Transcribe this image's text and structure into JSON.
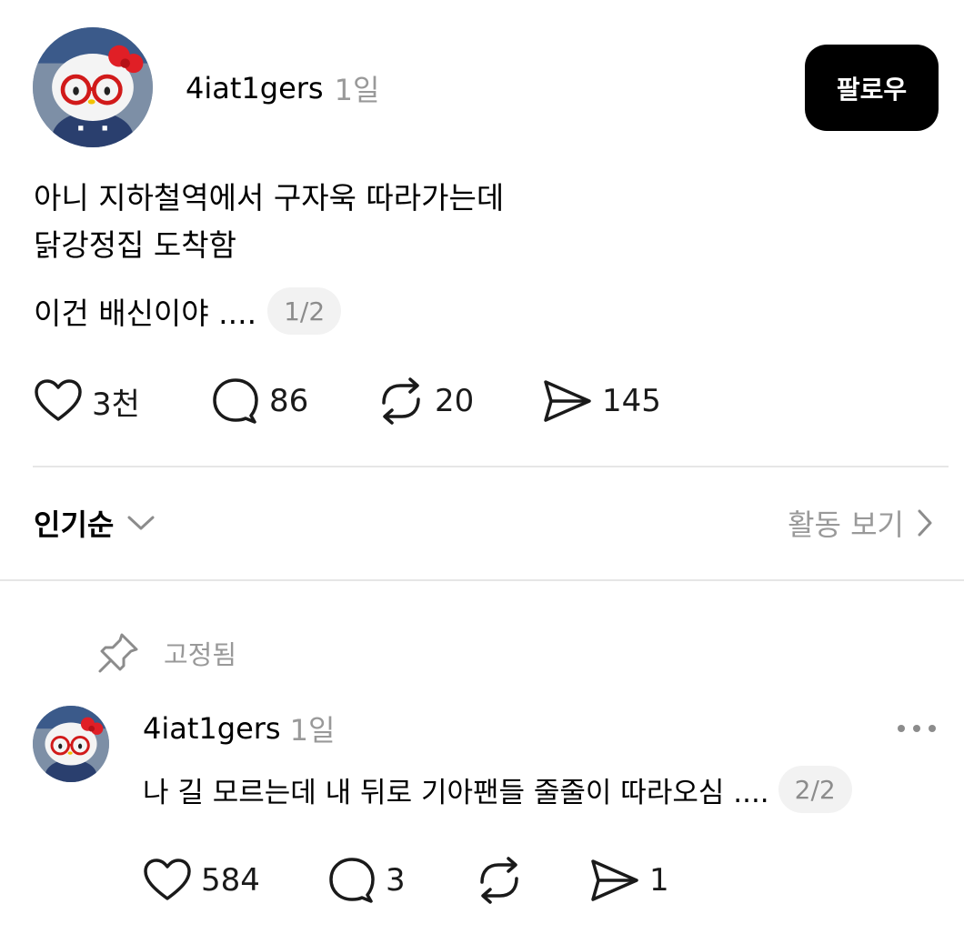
{
  "post": {
    "username": "4iat1gers",
    "time": "1일",
    "follow_label": "팔로우",
    "lines": [
      "아니 지하철역에서 구자욱 따라가는데",
      "닭강정집 도착함"
    ],
    "line3": "이건 배신이야 ....",
    "page_badge": "1/2",
    "actions": {
      "likes": "3천",
      "comments": "86",
      "reposts": "20",
      "shares": "145"
    }
  },
  "sort": {
    "label": "인기순",
    "activity_label": "활동 보기"
  },
  "reply": {
    "pinned_label": "고정됨",
    "username": "4iat1gers",
    "time": "1일",
    "text": "나 길 모르는데 내 뒤로 기아팬들 줄줄이 따라오심 ....",
    "page_badge": "2/2",
    "actions": {
      "likes": "584",
      "comments": "3",
      "reposts": "",
      "shares": "1"
    }
  },
  "colors": {
    "follow_bg": "#000000",
    "muted_text": "#999999",
    "divider": "#e6e6e6"
  },
  "icons": [
    "heart-icon",
    "comment-icon",
    "repost-icon",
    "share-icon",
    "chevron-down-icon",
    "chevron-right-icon",
    "pin-icon",
    "more-icon"
  ]
}
